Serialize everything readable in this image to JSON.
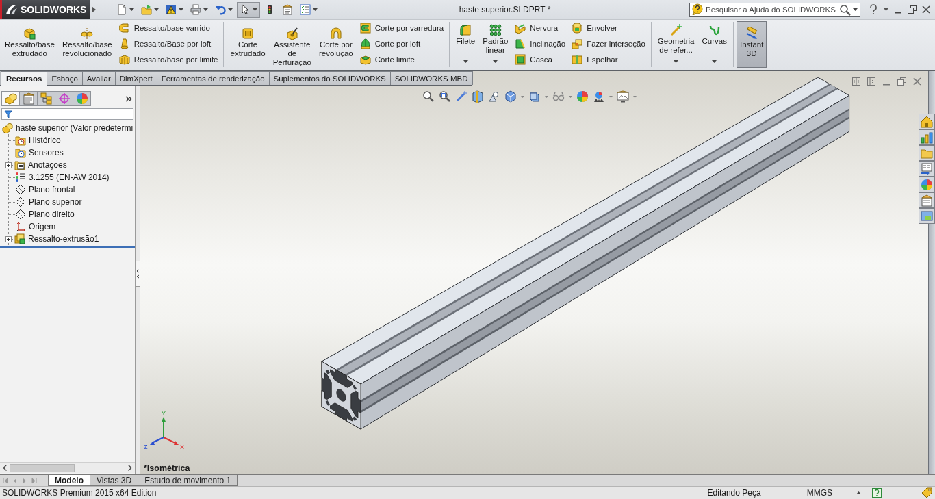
{
  "window": {
    "title": "haste superior.SLDPRT *"
  },
  "logo": {
    "text": "SOLIDWORKS"
  },
  "quick_access": [
    {
      "menu": true,
      "selected": false
    },
    {
      "menu": true,
      "selected": false
    },
    {
      "menu": true,
      "selected": false
    },
    {
      "menu": true,
      "selected": false
    },
    {
      "menu": true,
      "selected": false
    },
    {
      "menu": true,
      "selected": true
    },
    {
      "menu": false,
      "selected": false
    },
    {
      "menu": false,
      "selected": false
    },
    {
      "menu": true,
      "selected": false
    }
  ],
  "search": {
    "placeholder": "Pesquisar a Ajuda do SOLIDWORKS"
  },
  "ribbon": {
    "groups": [
      {
        "large": [
          {
            "label": "Ressalto/base\nextrudado",
            "menu": false
          },
          {
            "label": "Ressalto/base\nrevolucionado",
            "menu": false
          }
        ],
        "stacks": [
          [
            "Ressalto/base varrido",
            "Ressalto/Base por loft",
            "Ressalto/base por limite"
          ]
        ]
      },
      {
        "large": [
          {
            "label": "Corte\nextrudado",
            "menu": false
          },
          {
            "label": "Assistente\nde\nPerfuração",
            "menu": false
          },
          {
            "label": "Corte por\nrevolução",
            "menu": false
          }
        ],
        "stacks": [
          [
            "Corte por varredura",
            "Corte por loft",
            "Corte limite"
          ]
        ]
      },
      {
        "large": [
          {
            "label": "Filete",
            "menu": true
          },
          {
            "label": "Padrão\nlinear",
            "menu": true
          }
        ],
        "stacks": [
          [
            "Nervura",
            "Inclinação",
            "Casca"
          ],
          [
            "Envolver",
            "Fazer interseção",
            "Espelhar"
          ]
        ]
      },
      {
        "large": [
          {
            "label": "Geometria\nde refer...",
            "menu": true
          },
          {
            "label": "Curvas",
            "menu": true
          }
        ]
      },
      {
        "large": [
          {
            "label": "Instant\n3D",
            "menu": false,
            "on": true
          }
        ]
      }
    ]
  },
  "command_tabs": [
    {
      "label": "Recursos",
      "selected": true
    },
    {
      "label": "Esboço",
      "selected": false
    },
    {
      "label": "Avaliar",
      "selected": false
    },
    {
      "label": "DimXpert",
      "selected": false
    },
    {
      "label": "Ferramentas de renderização",
      "selected": false
    },
    {
      "label": "Suplementos do SOLIDWORKS",
      "selected": false
    },
    {
      "label": "SOLIDWORKS MBD",
      "selected": false
    }
  ],
  "feature_panel": {
    "tabs": [
      {
        "selected": true
      },
      {
        "selected": false
      },
      {
        "selected": false
      },
      {
        "selected": false
      },
      {
        "selected": false
      }
    ],
    "tree": {
      "label": "haste superior (Valor predetermi",
      "kind": "part",
      "children": [
        {
          "label": "Histórico",
          "kind": "history"
        },
        {
          "label": "Sensores",
          "kind": "sensors"
        },
        {
          "label": "Anotações",
          "kind": "annotations",
          "expanded": false
        },
        {
          "label": "3.1255 (EN-AW 2014)",
          "kind": "material"
        },
        {
          "label": "Plano frontal",
          "kind": "plane"
        },
        {
          "label": "Plano superior",
          "kind": "plane"
        },
        {
          "label": "Plano direito",
          "kind": "plane"
        },
        {
          "label": "Origem",
          "kind": "origin"
        },
        {
          "label": "Ressalto-extrusão1",
          "kind": "feature",
          "expanded": false
        }
      ]
    }
  },
  "viewport": {
    "view_name": "*Isométrica",
    "axis_labels": [
      "X",
      "Y",
      "Z"
    ]
  },
  "model_tabs": [
    {
      "label": "Modelo",
      "selected": true
    },
    {
      "label": "Vistas 3D",
      "selected": false
    },
    {
      "label": "Estudo de movimento 1",
      "selected": false
    }
  ],
  "status_bar": {
    "edition": "SOLIDWORKS Premium 2015 x64 Edition",
    "mode": "Editando Peça",
    "units": "MMGS"
  }
}
